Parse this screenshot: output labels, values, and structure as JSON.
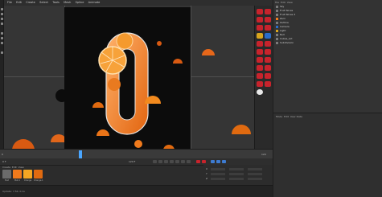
{
  "app": {
    "menu": [
      "File",
      "Edit",
      "Create",
      "Select",
      "Tools",
      "Mesh",
      "Spline",
      "Animate",
      "Simulate",
      "Tracker",
      "Render",
      "Sculpt",
      "MoGraph",
      "Character",
      "Pipeline",
      "Plugins",
      "Script",
      "Window",
      "Help"
    ],
    "layout_label": "Layout:"
  },
  "object_manager": {
    "header": [
      "File",
      "Edit",
      "View",
      "Object",
      "Tags",
      "Bookmarks"
    ],
    "objects": [
      {
        "name": "Sky"
      },
      {
        "name": "Fruit Slices"
      },
      {
        "name": "Fruit Slices 2"
      },
      {
        "name": "Zero"
      },
      {
        "name": "Outline"
      },
      {
        "name": "Camera"
      },
      {
        "name": "Light"
      },
      {
        "name": "Null"
      },
      {
        "name": "Cubes_Lot"
      },
      {
        "name": "Subdivision"
      }
    ]
  },
  "attribute_manager": {
    "header": [
      "Mode",
      "Edit",
      "User Data"
    ]
  },
  "timeline": {
    "start": "0 F",
    "end": "120 F",
    "current_frame": "35",
    "ticks": [
      "0",
      "5",
      "10",
      "15",
      "20",
      "25",
      "30",
      "35",
      "40",
      "45",
      "50",
      "55",
      "60",
      "65",
      "70",
      "75",
      "80",
      "85",
      "90",
      "95",
      "100",
      "105",
      "110",
      "115",
      "120"
    ]
  },
  "transport": {
    "start_field": "0 F",
    "end_field": "120 F"
  },
  "materials": {
    "menu": [
      "Create",
      "Edit",
      "View",
      "Select",
      "Material",
      "Texture",
      "Cycles 4D"
    ],
    "items": [
      {
        "label": "Mat",
        "color": "#6b6b6b"
      },
      {
        "label": "Mat.1",
        "color": "#f07a1c"
      },
      {
        "label": "Orange",
        "color": "#f5a623"
      },
      {
        "label": "Orange.1",
        "color": "#e06a10"
      }
    ]
  },
  "coordinates": {
    "rows": [
      "X",
      "Y",
      "Z"
    ],
    "mode": "Object (Rel)",
    "size": "Size",
    "apply": "Apply"
  },
  "status": {
    "text": "Update: 7.5K, 0.1s"
  },
  "colors": {
    "accent_red": "#c8232c",
    "orange": "#f07a1c",
    "render_bg": "#0c0c0c"
  },
  "icons": [
    "scene-icon",
    "render-icon",
    "light-icon",
    "camera-icon"
  ]
}
